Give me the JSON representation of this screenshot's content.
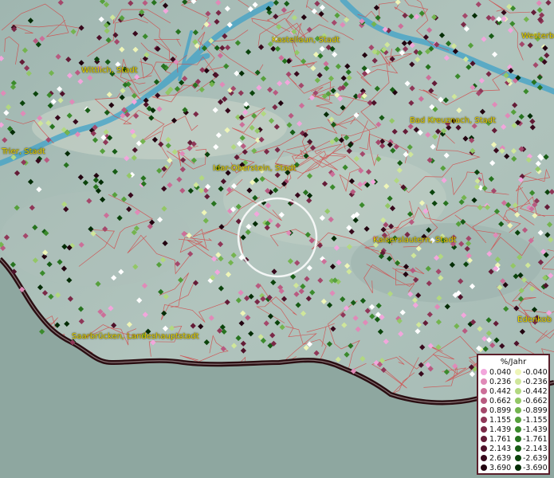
{
  "cities": [
    {
      "id": "kastellaun",
      "name": "Kastellaun, Stadt"
    },
    {
      "id": "westerburg",
      "name": "Westerb"
    },
    {
      "id": "wittlich",
      "name": "Wittlich, Stadt"
    },
    {
      "id": "bad-kreuznach",
      "name": "Bad Kreuznach, Stadt"
    },
    {
      "id": "trier",
      "name": "Trier, Stadt"
    },
    {
      "id": "idar-oberstein",
      "name": "Idar-Oberstein, Stadt"
    },
    {
      "id": "kaiserslautern",
      "name": "Kaiserslautern, Stadt"
    },
    {
      "id": "edenkoben",
      "name": "Edenkob"
    },
    {
      "id": "saarbruecken",
      "name": "Saarbrücken, Landeshauptstadt"
    }
  ],
  "legend": {
    "title": "%/Jahr",
    "positive": [
      {
        "label": "0.040",
        "color": "#f2a6dc"
      },
      {
        "label": "0.236",
        "color": "#e08ab8"
      },
      {
        "label": "0.442",
        "color": "#cc6f99"
      },
      {
        "label": "0.662",
        "color": "#b85a80"
      },
      {
        "label": "0.899",
        "color": "#a4486b"
      },
      {
        "label": "1.155",
        "color": "#8f3758"
      },
      {
        "label": "1.439",
        "color": "#7a2947"
      },
      {
        "label": "1.761",
        "color": "#641c37"
      },
      {
        "label": "2.143",
        "color": "#4e122a"
      },
      {
        "label": "2.639",
        "color": "#38091c"
      },
      {
        "label": "3.690",
        "color": "#220410"
      }
    ],
    "negative": [
      {
        "label": "-0.040",
        "color": "#eef5b8"
      },
      {
        "label": "-0.236",
        "color": "#cfe69a"
      },
      {
        "label": "-0.442",
        "color": "#b2d880"
      },
      {
        "label": "-0.662",
        "color": "#93c766"
      },
      {
        "label": "-0.899",
        "color": "#74b44f"
      },
      {
        "label": "-1.155",
        "color": "#56a03c"
      },
      {
        "label": "-1.439",
        "color": "#3b8a2c"
      },
      {
        "label": "-1.761",
        "color": "#27731f"
      },
      {
        "label": "-2.143",
        "color": "#175c15"
      },
      {
        "label": "-2.639",
        "color": "#0b440c"
      },
      {
        "label": "-3.690",
        "color": "#042c06"
      }
    ]
  },
  "colors": {
    "label": "#e8d200",
    "border": "#5a1e2a",
    "boundary": "#d24a4a",
    "water": "#3fa1c8"
  }
}
